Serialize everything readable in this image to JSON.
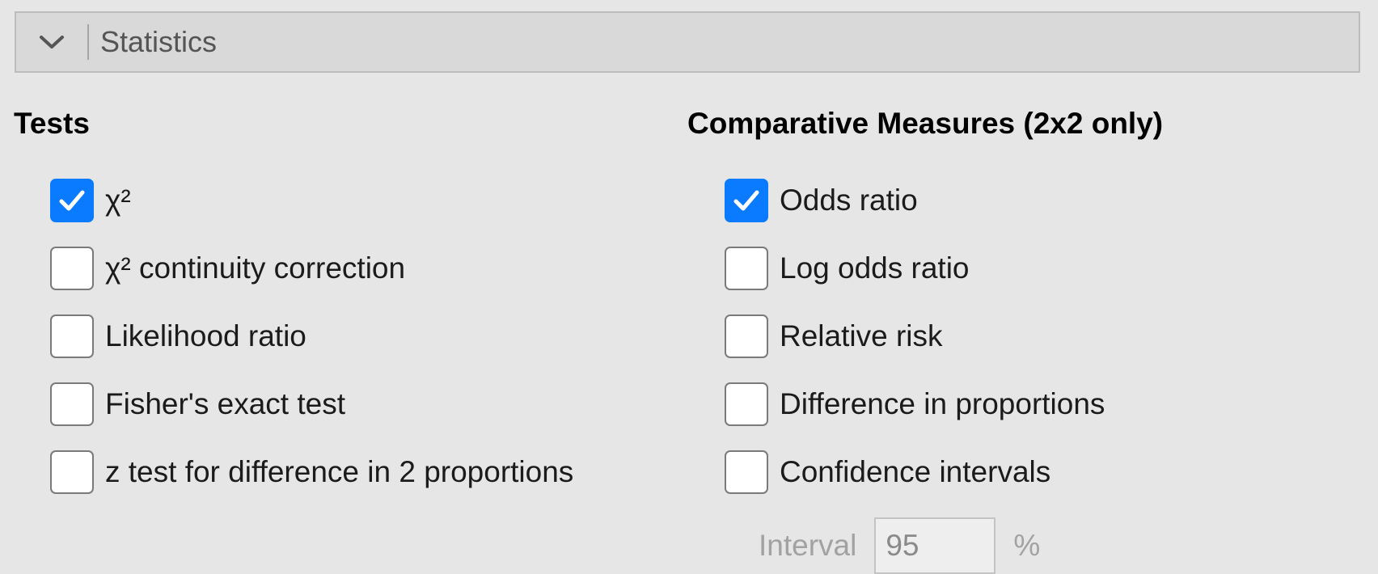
{
  "panel": {
    "title": "Statistics",
    "collapse_icon": "chevron-down-icon"
  },
  "tests": {
    "title": "Tests",
    "options": [
      {
        "label": "χ²",
        "checked": true
      },
      {
        "label": "χ² continuity correction",
        "checked": false
      },
      {
        "label": "Likelihood ratio",
        "checked": false
      },
      {
        "label": "Fisher's exact test",
        "checked": false
      },
      {
        "label": "z test for difference in 2 proportions",
        "checked": false
      }
    ]
  },
  "comparative": {
    "title": "Comparative Measures (2x2 only)",
    "options": [
      {
        "label": "Odds ratio",
        "checked": true
      },
      {
        "label": "Log odds ratio",
        "checked": false
      },
      {
        "label": "Relative risk",
        "checked": false
      },
      {
        "label": "Difference in proportions",
        "checked": false
      },
      {
        "label": "Confidence intervals",
        "checked": false
      }
    ],
    "interval": {
      "label": "Interval",
      "value": "95",
      "unit": "%",
      "enabled": false
    }
  },
  "colors": {
    "accent": "#0a7aff",
    "background": "#e6e6e6",
    "header_background": "#d9d9d9"
  }
}
